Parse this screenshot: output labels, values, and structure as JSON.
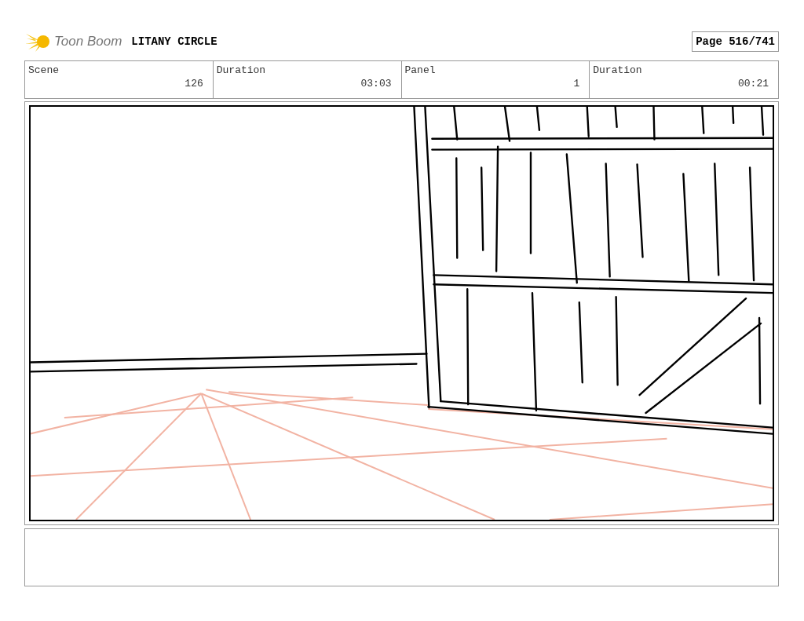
{
  "header": {
    "logo_text": "Toon Boom",
    "title": "LITANY CIRCLE",
    "page": "Page 516/741"
  },
  "info": [
    {
      "label": "Scene",
      "value": "126"
    },
    {
      "label": "Duration",
      "value": "03:03"
    },
    {
      "label": "Panel",
      "value": "1"
    },
    {
      "label": "Duration",
      "value": "00:21"
    }
  ]
}
